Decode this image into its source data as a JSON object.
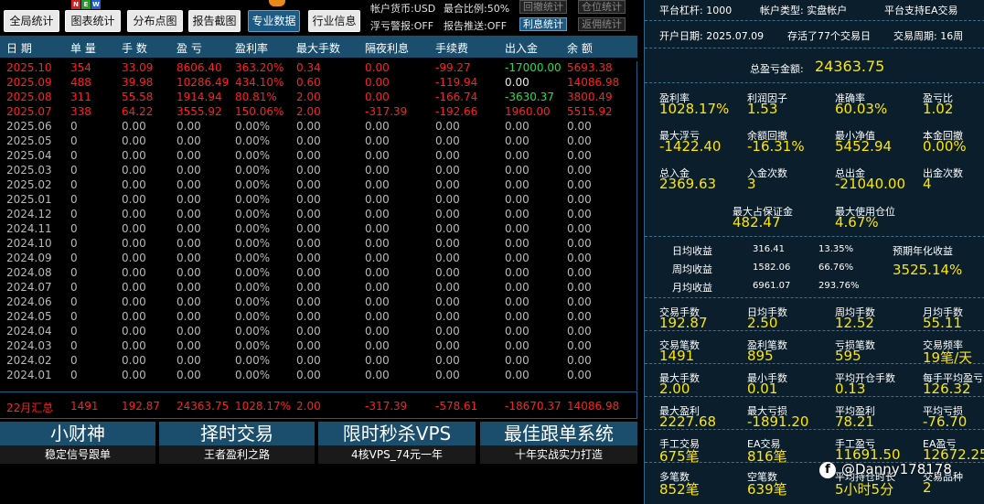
{
  "toolbar": {
    "buttons": [
      "全局统计",
      "图表统计",
      "分布点图",
      "报告截图",
      "专业数据",
      "行业信息"
    ],
    "new_badge": [
      "N",
      "E",
      "W"
    ],
    "currency": "帐户货币:USD",
    "max_ratio": "最合比例:50%",
    "float_warn": "浮亏警报:OFF",
    "report_push": "报告推送:OFF",
    "drawdown_btn": "回撤统计",
    "position_btn": "仓位统计",
    "interest_btn": "利息统计",
    "rebate_btn": "返佣统计"
  },
  "table": {
    "headers": [
      "日 期",
      "单 量",
      "手 数",
      "盈 亏",
      "盈利率",
      "最大手数",
      "隔夜利息",
      "手续费",
      "出入金",
      "余 额"
    ],
    "rows": [
      {
        "c": [
          "2025.10",
          "354",
          "33.09",
          "8606.40",
          "363.20%",
          "0.34",
          "0.00",
          "-99.27",
          "-17000.00",
          "5693.38"
        ],
        "k": "r",
        "g": 8
      },
      {
        "c": [
          "2025.09",
          "488",
          "39.98",
          "10286.49",
          "434.10%",
          "0.60",
          "0.00",
          "-119.94",
          "0.00",
          "14086.98"
        ],
        "k": "r",
        "g": -1
      },
      {
        "c": [
          "2025.08",
          "311",
          "55.58",
          "1914.94",
          "80.81%",
          "2.00",
          "0.00",
          "-166.74",
          "-3630.37",
          "3800.49"
        ],
        "k": "r",
        "g": 8
      },
      {
        "c": [
          "2025.07",
          "338",
          "64.22",
          "3555.92",
          "150.06%",
          "2.00",
          "-317.39",
          "-192.66",
          "1960.00",
          "5515.92"
        ],
        "k": "r",
        "g": -1
      },
      {
        "c": [
          "2025.06",
          "0",
          "0.00",
          "0.00",
          "0.00%",
          "0.00",
          "0.00",
          "0.00",
          "0.00",
          "0.00"
        ],
        "k": "w"
      },
      {
        "c": [
          "2025.05",
          "0",
          "0.00",
          "0.00",
          "0.00%",
          "0.00",
          "0.00",
          "0.00",
          "0.00",
          "0.00"
        ],
        "k": "w"
      },
      {
        "c": [
          "2025.04",
          "0",
          "0.00",
          "0.00",
          "0.00%",
          "0.00",
          "0.00",
          "0.00",
          "0.00",
          "0.00"
        ],
        "k": "w"
      },
      {
        "c": [
          "2025.03",
          "0",
          "0.00",
          "0.00",
          "0.00%",
          "0.00",
          "0.00",
          "0.00",
          "0.00",
          "0.00"
        ],
        "k": "w"
      },
      {
        "c": [
          "2025.02",
          "0",
          "0.00",
          "0.00",
          "0.00%",
          "0.00",
          "0.00",
          "0.00",
          "0.00",
          "0.00"
        ],
        "k": "w"
      },
      {
        "c": [
          "2025.01",
          "0",
          "0.00",
          "0.00",
          "0.00%",
          "0.00",
          "0.00",
          "0.00",
          "0.00",
          "0.00"
        ],
        "k": "w"
      },
      {
        "c": [
          "2024.12",
          "0",
          "0.00",
          "0.00",
          "0.00%",
          "0.00",
          "0.00",
          "0.00",
          "0.00",
          "0.00"
        ],
        "k": "w"
      },
      {
        "c": [
          "2024.11",
          "0",
          "0.00",
          "0.00",
          "0.00%",
          "0.00",
          "0.00",
          "0.00",
          "0.00",
          "0.00"
        ],
        "k": "w"
      },
      {
        "c": [
          "2024.10",
          "0",
          "0.00",
          "0.00",
          "0.00%",
          "0.00",
          "0.00",
          "0.00",
          "0.00",
          "0.00"
        ],
        "k": "w"
      },
      {
        "c": [
          "2024.09",
          "0",
          "0.00",
          "0.00",
          "0.00%",
          "0.00",
          "0.00",
          "0.00",
          "0.00",
          "0.00"
        ],
        "k": "w"
      },
      {
        "c": [
          "2024.08",
          "0",
          "0.00",
          "0.00",
          "0.00%",
          "0.00",
          "0.00",
          "0.00",
          "0.00",
          "0.00"
        ],
        "k": "w"
      },
      {
        "c": [
          "2024.07",
          "0",
          "0.00",
          "0.00",
          "0.00%",
          "0.00",
          "0.00",
          "0.00",
          "0.00",
          "0.00"
        ],
        "k": "w"
      },
      {
        "c": [
          "2024.06",
          "0",
          "0.00",
          "0.00",
          "0.00%",
          "0.00",
          "0.00",
          "0.00",
          "0.00",
          "0.00"
        ],
        "k": "w"
      },
      {
        "c": [
          "2024.05",
          "0",
          "0.00",
          "0.00",
          "0.00%",
          "0.00",
          "0.00",
          "0.00",
          "0.00",
          "0.00"
        ],
        "k": "w"
      },
      {
        "c": [
          "2024.04",
          "0",
          "0.00",
          "0.00",
          "0.00%",
          "0.00",
          "0.00",
          "0.00",
          "0.00",
          "0.00"
        ],
        "k": "w"
      },
      {
        "c": [
          "2024.03",
          "0",
          "0.00",
          "0.00",
          "0.00%",
          "0.00",
          "0.00",
          "0.00",
          "0.00",
          "0.00"
        ],
        "k": "w"
      },
      {
        "c": [
          "2024.02",
          "0",
          "0.00",
          "0.00",
          "0.00%",
          "0.00",
          "0.00",
          "0.00",
          "0.00",
          "0.00"
        ],
        "k": "w"
      },
      {
        "c": [
          "2024.01",
          "0",
          "0.00",
          "0.00",
          "0.00%",
          "0.00",
          "0.00",
          "0.00",
          "0.00",
          "0.00"
        ],
        "k": "w"
      }
    ],
    "summary": [
      "22月汇总",
      "1491",
      "192.87",
      "24363.75",
      "1028.17%",
      "2.00",
      "-317.39",
      "-578.61",
      "-18670.37",
      "14086.98"
    ]
  },
  "banners": [
    {
      "title": "小财神",
      "sub": "稳定信号跟单"
    },
    {
      "title": "择时交易",
      "sub": "王者盈利之路"
    },
    {
      "title": "限时秒杀VPS",
      "sub": "4核VPS_74元一年"
    },
    {
      "title": "最佳跟单系统",
      "sub": "十年实战实力打造"
    }
  ],
  "right": {
    "row1": [
      "平台杠杆: 1000",
      "帐户类型: 实盘帐户",
      "平台支持EA交易"
    ],
    "row2": [
      "开户日期: 2025.07.09",
      "存活了77个交易日",
      "交易周期: 16周"
    ],
    "total_label": "总盈亏金额:",
    "total_value": "24363.75",
    "grid1": [
      {
        "l": "盈利率",
        "v": "1028.17%"
      },
      {
        "l": "利润因子",
        "v": "1.53"
      },
      {
        "l": "准确率",
        "v": "60.03%"
      },
      {
        "l": "盈亏比",
        "v": "1.02"
      },
      {
        "l": "最大浮亏",
        "v": "-1422.40"
      },
      {
        "l": "余额回撤",
        "v": "-16.31%"
      },
      {
        "l": "最小净值",
        "v": "5452.94"
      },
      {
        "l": "本金回撤",
        "v": "0.00%"
      },
      {
        "l": "总入金",
        "v": "2369.63"
      },
      {
        "l": "入金次数",
        "v": "3"
      },
      {
        "l": "总出金",
        "v": "-21040.00"
      },
      {
        "l": "出金次数",
        "v": "4"
      }
    ],
    "margin": [
      {
        "l": "最大占保证金",
        "v": "482.47"
      },
      {
        "l": "最大使用仓位",
        "v": "4.67%"
      }
    ],
    "returns": [
      {
        "l": "日均收益",
        "a": "316.41",
        "p": "13.35%"
      },
      {
        "l": "周均收益",
        "a": "1582.06",
        "p": "66.76%"
      },
      {
        "l": "月均收益",
        "a": "6961.07",
        "p": "293.76%"
      }
    ],
    "annual_label": "预期年化收益",
    "annual_value": "3525.14%",
    "grid2": [
      {
        "l": "交易手数",
        "v": "192.87"
      },
      {
        "l": "日均手数",
        "v": "2.50"
      },
      {
        "l": "周均手数",
        "v": "12.52"
      },
      {
        "l": "月均手数",
        "v": "55.11"
      },
      {
        "l": "交易笔数",
        "v": "1491"
      },
      {
        "l": "盈利笔数",
        "v": "895"
      },
      {
        "l": "亏损笔数",
        "v": "595"
      },
      {
        "l": "交易频率",
        "v": "19笔/天"
      },
      {
        "l": "最大手数",
        "v": "2.00"
      },
      {
        "l": "最小手数",
        "v": "0.01"
      },
      {
        "l": "平均开仓手数",
        "v": "0.13"
      },
      {
        "l": "每手平均盈亏",
        "v": "126.32"
      },
      {
        "l": "最大盈利",
        "v": "2227.68"
      },
      {
        "l": "最大亏损",
        "v": "-1891.20"
      },
      {
        "l": "平均盈利",
        "v": "78.21"
      },
      {
        "l": "平均亏损",
        "v": "-76.70"
      },
      {
        "l": "手工交易",
        "v": "675笔"
      },
      {
        "l": "EA交易",
        "v": "816笔"
      },
      {
        "l": "手工盈亏",
        "v": "11691.50"
      },
      {
        "l": "EA盈亏",
        "v": "12672.25"
      },
      {
        "l": "多笔数",
        "v": "852笔"
      },
      {
        "l": "空笔数",
        "v": "639笔"
      },
      {
        "l": "平均持仓时长",
        "v": "5小时5分"
      },
      {
        "l": "交易品种",
        "v": "2"
      }
    ]
  },
  "watermark": {
    "icon": "f",
    "text": "@Danny178178"
  },
  "colors": {
    "header_bg": "#1b4e6c",
    "accent_yellow": "#ffe600",
    "loss_red": "#ff2020",
    "gain_green": "#22e040",
    "panel_bg": "#0b1e2c"
  }
}
